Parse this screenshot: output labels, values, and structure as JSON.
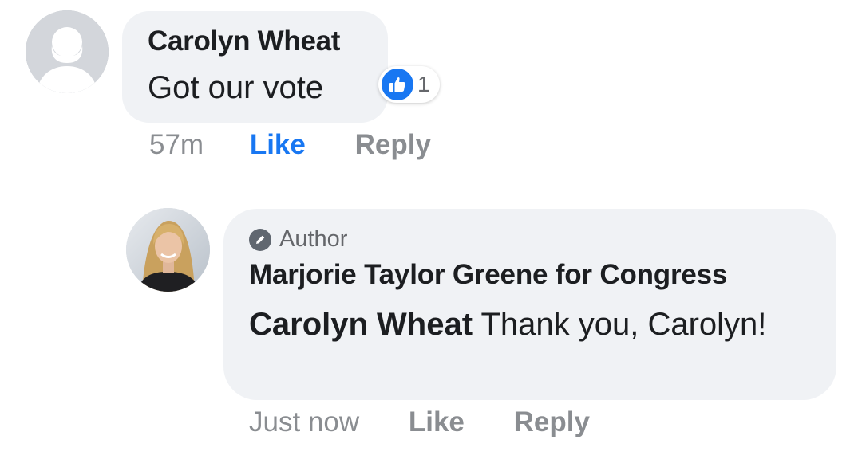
{
  "comment": {
    "author": "Carolyn Wheat",
    "text": "Got our vote",
    "reaction_count": "1",
    "reaction_icon": "like-thumbs-up-icon",
    "time": "57m",
    "like_label": "Like",
    "reply_label": "Reply",
    "like_active_color": "#1877f2"
  },
  "reply": {
    "badge_icon": "pencil-icon",
    "badge": "Author",
    "author": "Marjorie Taylor Greene for Congress",
    "mention": "Carolyn Wheat",
    "text": "Thank you, Carolyn!",
    "time": "Just now",
    "like_label": "Like",
    "reply_label": "Reply"
  },
  "colors": {
    "bubble": "#f0f2f5",
    "text": "#1c1e21",
    "muted": "#8a8d91",
    "accent": "#1877f2"
  }
}
